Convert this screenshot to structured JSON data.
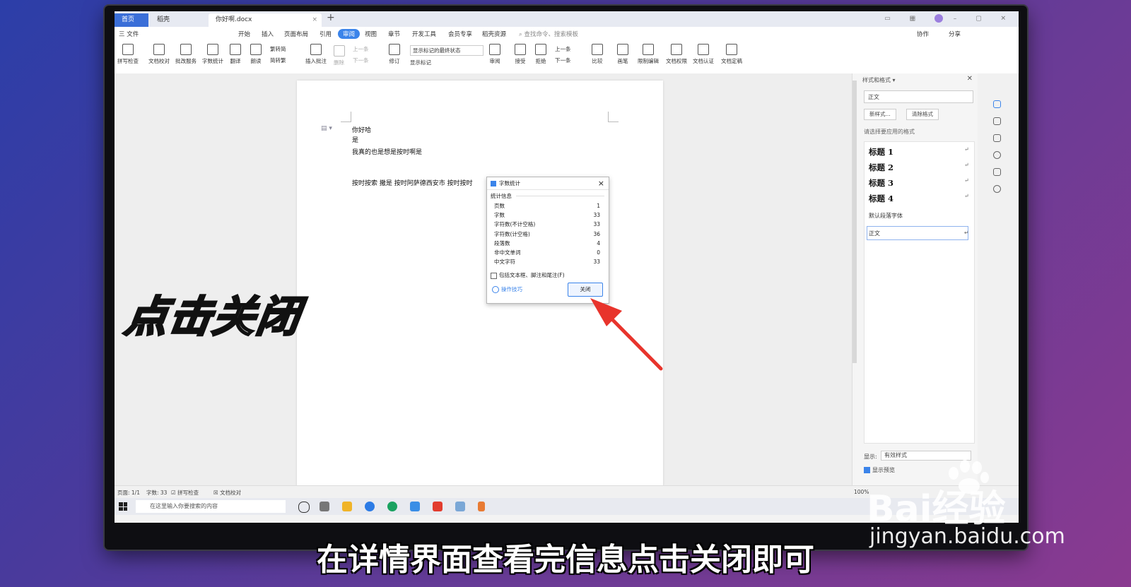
{
  "titlebar": {
    "tabs": [
      "首页",
      "稻壳",
      "你好啊.docx"
    ],
    "close_glyph": "×",
    "new_tab": "+"
  },
  "menubar": {
    "file": "三 文件",
    "items": [
      "开始",
      "插入",
      "页面布局",
      "引用",
      "审阅",
      "视图",
      "章节",
      "开发工具",
      "会员专享",
      "稻壳资源"
    ],
    "active": "审阅",
    "search": "查找命令、搜索模板",
    "right": [
      "协作",
      "分享"
    ]
  },
  "ribbon": {
    "buttons": [
      "拼写检查",
      "文档校对",
      "批改服务",
      "字数统计",
      "翻译",
      "朗读",
      "插入批注",
      "修订",
      "审阅",
      "接受",
      "拒绝",
      "比较",
      "画笔",
      "限制编辑",
      "文档权限",
      "文档认证",
      "文档定稿"
    ],
    "small": [
      "繁转简",
      "简转繁",
      "删除",
      "上一条",
      "下一条",
      "上一条",
      "下一条"
    ],
    "markup_state": "显示标记的最终状态",
    "show_markup": "显示标记"
  },
  "document": {
    "lines": [
      "你好哈",
      "是",
      "我真的也是想是按时啊是",
      "按时按索 撒是 按时阿萨德西安市 按时按时"
    ]
  },
  "dialog": {
    "title": "字数统计",
    "section": "统计信息",
    "stats": [
      {
        "label": "页数",
        "value": "1"
      },
      {
        "label": "字数",
        "value": "33"
      },
      {
        "label": "字符数(不计空格)",
        "value": "33"
      },
      {
        "label": "字符数(计空格)",
        "value": "36"
      },
      {
        "label": "段落数",
        "value": "4"
      },
      {
        "label": "非中文单词",
        "value": "0"
      },
      {
        "label": "中文字符",
        "value": "33"
      }
    ],
    "checkbox": "包括文本框、脚注和尾注(F)",
    "tips": "操作技巧",
    "close_button": "关闭",
    "close_glyph": "×"
  },
  "style_panel": {
    "title": "样式和格式 ▾",
    "current": "正文",
    "new_style": "新样式...",
    "clear": "清除格式",
    "prompt": "请选择要应用的格式",
    "styles": [
      "标题 1",
      "标题 2",
      "标题 3",
      "标题 4"
    ],
    "default_font": "默认段落字体",
    "body": "正文",
    "return_glyph": "↵",
    "show_label": "显示:",
    "show_value": "有效样式",
    "preview": "显示预览"
  },
  "statusbar": {
    "page": "页面: 1/1",
    "words": "字数: 33",
    "spell": "拼写检查",
    "proof": "文档校对",
    "zoom": "100%"
  },
  "taskbar": {
    "search_placeholder": "在这里输入你要搜索的内容"
  },
  "overlay": {
    "big_text": "点击关闭",
    "caption": "在详情界面查看完信息点击关闭即可"
  },
  "watermark": {
    "logo": "Bai经验",
    "url": "jingyan.baidu.com"
  },
  "colors": {
    "accent": "#3b84ea",
    "arrow": "#e8342c"
  }
}
